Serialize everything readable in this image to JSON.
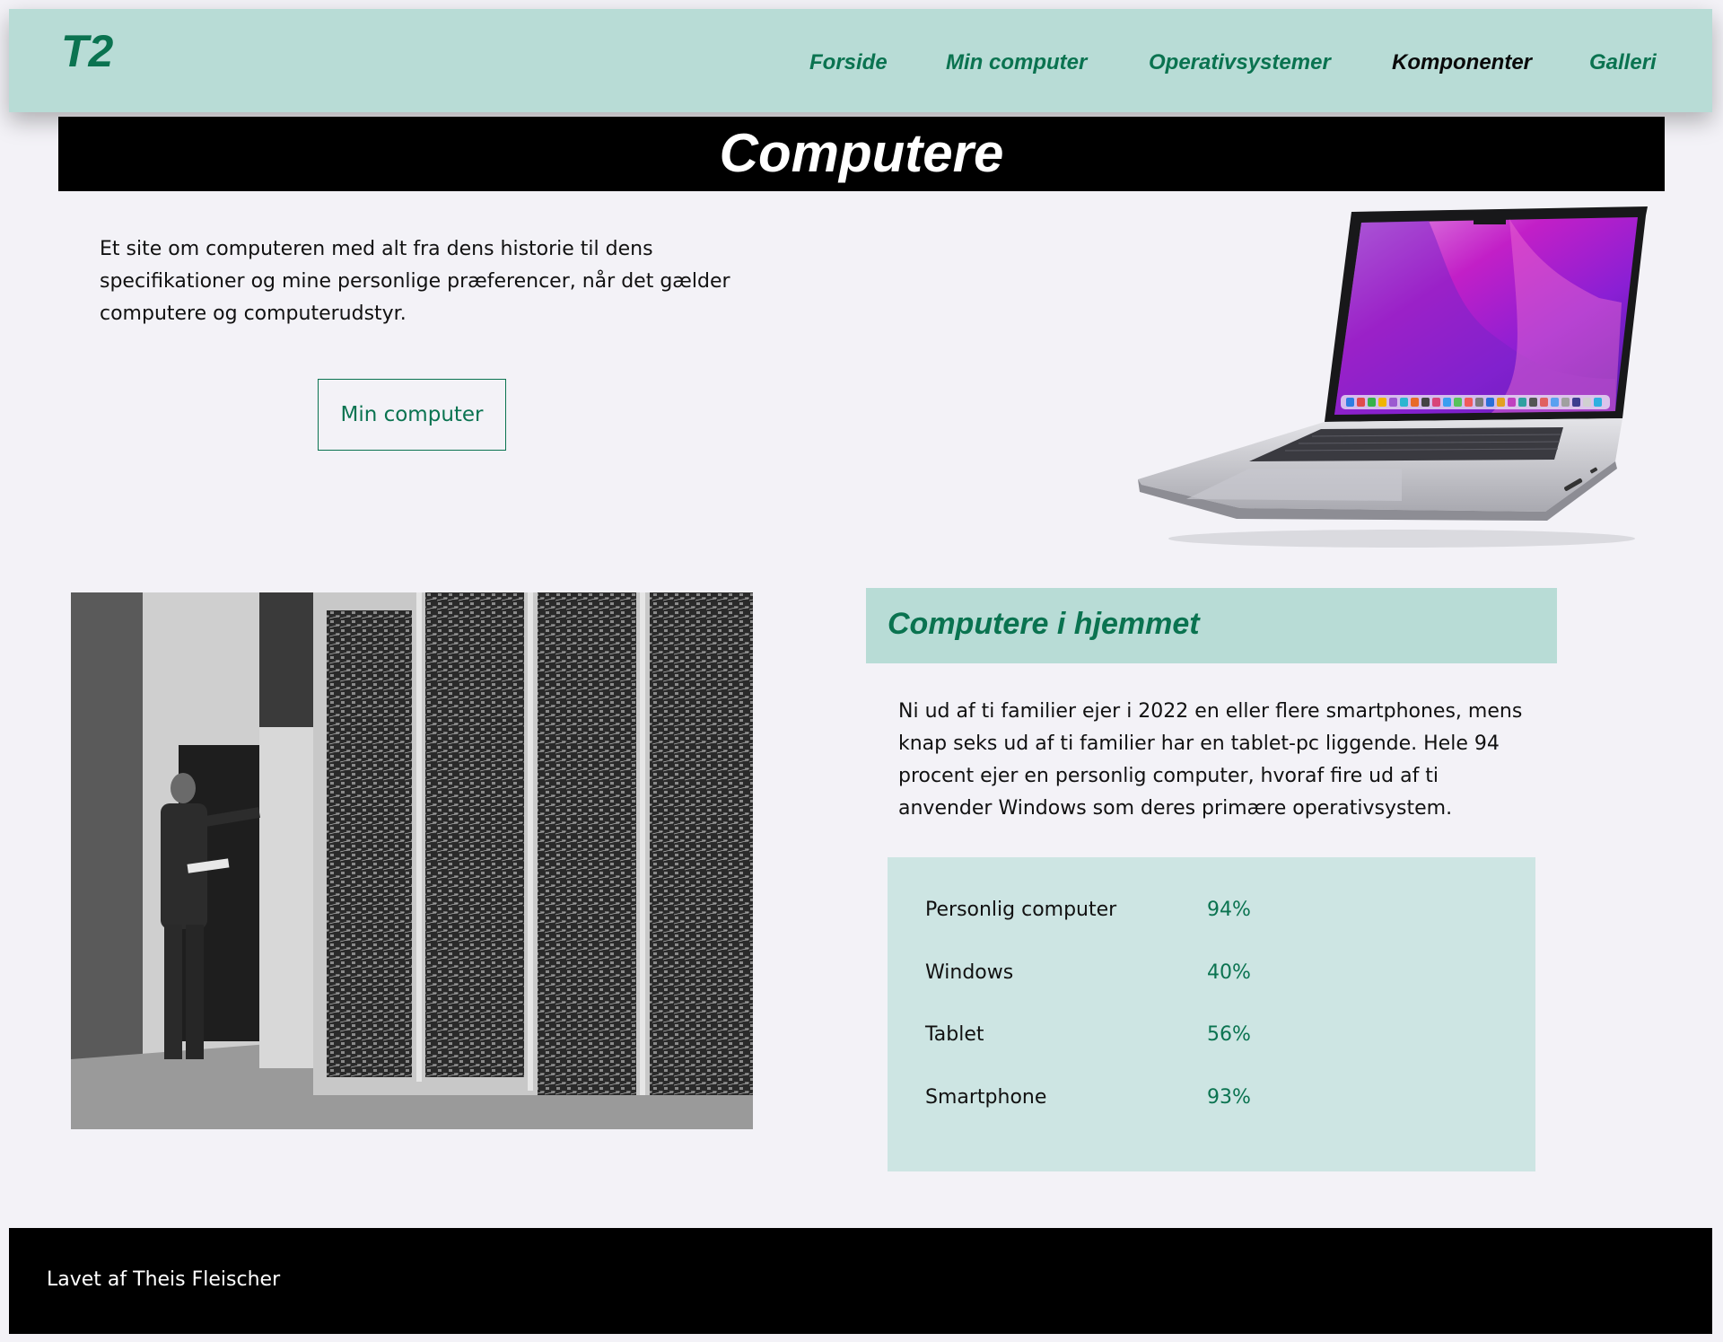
{
  "header": {
    "logo": "T2",
    "nav": [
      {
        "label": "Forside",
        "active": false
      },
      {
        "label": "Min computer",
        "active": false
      },
      {
        "label": "Operativsystemer",
        "active": false
      },
      {
        "label": "Komponenter",
        "active": true
      },
      {
        "label": "Galleri",
        "active": false
      }
    ]
  },
  "hero": {
    "title": "Computere",
    "intro": "Et site om computeren med alt fra dens historie til dens specifikationer og mine personlige præferencer, når det gælder computere og computerudstyr.",
    "button_label": "Min computer"
  },
  "section": {
    "title": "Computere i hjemmet",
    "text": "Ni ud af ti familier ejer i 2022 en eller flere smartphones, mens knap seks ud af ti familier har en tablet-pc liggende. Hele 94 procent ejer en personlig computer, hvoraf fire ud af ti anvender Windows som deres primære operativsystem.",
    "stats": [
      {
        "label": "Personlig computer",
        "value": "94%"
      },
      {
        "label": "Windows",
        "value": "40%"
      },
      {
        "label": "Tablet",
        "value": "56%"
      },
      {
        "label": "Smartphone",
        "value": "93%"
      }
    ]
  },
  "footer": {
    "text": "Lavet af Theis Fleischer"
  },
  "colors": {
    "accent": "#0a7350",
    "header_bg": "#b8dcd6",
    "panel_bg": "#cde5e3",
    "page_bg": "#f3f2f7"
  }
}
